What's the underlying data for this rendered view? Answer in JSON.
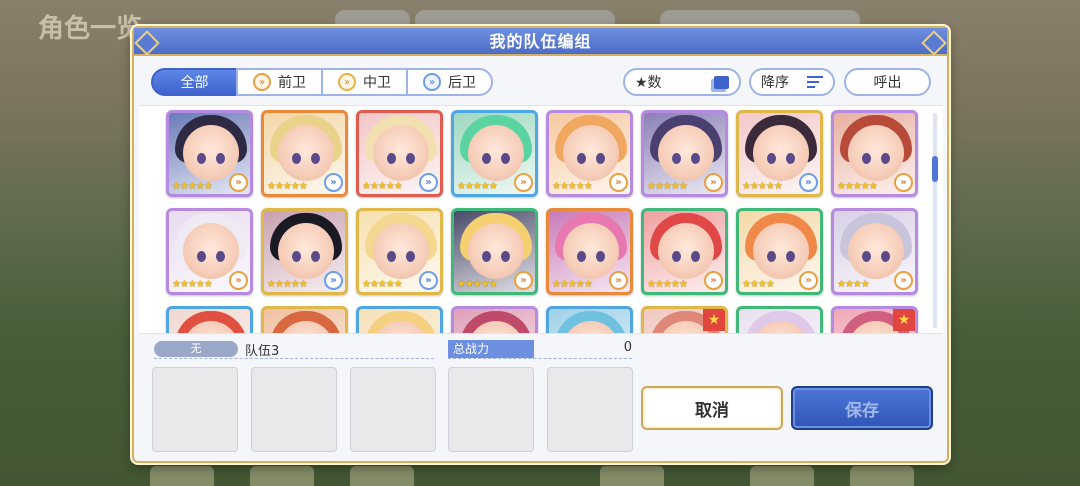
{
  "background": {
    "title": "角色一览"
  },
  "dialog": {
    "title": "我的队伍编组"
  },
  "filters": {
    "tabs": [
      {
        "label": "全部",
        "active": true,
        "icon": ""
      },
      {
        "label": "前卫",
        "active": false,
        "icon": "front-position-icon"
      },
      {
        "label": "中卫",
        "active": false,
        "icon": "middle-position-icon"
      },
      {
        "label": "后卫",
        "active": false,
        "icon": "back-position-icon"
      }
    ],
    "sort_label": "★数",
    "order_label": "降序",
    "call_label": "呼出"
  },
  "roster": {
    "rows": [
      [
        {
          "frame": "#b68ae0",
          "bg": "#6a7bb8",
          "hair": "#2e2a44",
          "stars": 5,
          "pos": "front"
        },
        {
          "frame": "#e98a3a",
          "bg": "#f3d7a8",
          "hair": "#e9d28a",
          "stars": 5,
          "pos": "back"
        },
        {
          "frame": "#e05c4e",
          "bg": "#f3c6c6",
          "hair": "#f2e0b0",
          "stars": 5,
          "pos": "back"
        },
        {
          "frame": "#4fa6e0",
          "bg": "#9fd8c0",
          "hair": "#5ad4a0",
          "stars": 5,
          "pos": "front"
        },
        {
          "frame": "#b68ae0",
          "bg": "#f6c9a0",
          "hair": "#f0a860",
          "stars": 5,
          "pos": "front"
        },
        {
          "frame": "#b68ae0",
          "bg": "#8a7fb8",
          "hair": "#4a4070",
          "stars": 5,
          "pos": "front"
        },
        {
          "frame": "#e0b84a",
          "bg": "#f3c8c8",
          "hair": "#3a2a3a",
          "stars": 5,
          "pos": "back"
        },
        {
          "frame": "#b68ae0",
          "bg": "#e8b0a0",
          "hair": "#b84a3a",
          "stars": 5,
          "pos": "front"
        }
      ],
      [
        {
          "frame": "#b68ae0",
          "bg": "#e8dcf0",
          "hair": "#f0eaf4",
          "stars": 5,
          "pos": "front"
        },
        {
          "frame": "#e0b84a",
          "bg": "#c8a0b0",
          "hair": "#1a1a24",
          "stars": 5,
          "pos": "back"
        },
        {
          "frame": "#e0b84a",
          "bg": "#f6e0b0",
          "hair": "#f4d890",
          "stars": 5,
          "pos": "back"
        },
        {
          "frame": "#3fb87a",
          "bg": "#4a4a6a",
          "hair": "#f4d070",
          "stars": 5,
          "pos": "front"
        },
        {
          "frame": "#e98a3a",
          "bg": "#c87ab8",
          "hair": "#e878b0",
          "stars": 5,
          "pos": "front"
        },
        {
          "frame": "#3fb87a",
          "bg": "#f0a0a0",
          "hair": "#e04848",
          "stars": 5,
          "pos": "front"
        },
        {
          "frame": "#3fb87a",
          "bg": "#f4d8a8",
          "hair": "#f08848",
          "stars": 4,
          "pos": "front"
        },
        {
          "frame": "#b68ae0",
          "bg": "#d8d0e8",
          "hair": "#c8c4dc",
          "stars": 4,
          "pos": "front"
        }
      ],
      [
        {
          "frame": "#4fa6e0",
          "bg": "#f0d8d0",
          "hair": "#e05040",
          "stars": 0,
          "pos": "",
          "badge": false
        },
        {
          "frame": "#e0b84a",
          "bg": "#f0c0a0",
          "hair": "#d86840",
          "stars": 0,
          "pos": "",
          "badge": false
        },
        {
          "frame": "#4fa6e0",
          "bg": "#f6e0b8",
          "hair": "#f4d080",
          "stars": 0,
          "pos": "",
          "badge": false
        },
        {
          "frame": "#b68ae0",
          "bg": "#e0a0b8",
          "hair": "#c04a6a",
          "stars": 0,
          "pos": "",
          "badge": false
        },
        {
          "frame": "#4fa6e0",
          "bg": "#a0d0e8",
          "hair": "#70c0e0",
          "stars": 0,
          "pos": "",
          "badge": false
        },
        {
          "frame": "#e0b84a",
          "bg": "#f0c8c0",
          "hair": "#e08878",
          "stars": 0,
          "pos": "",
          "badge": true
        },
        {
          "frame": "#3fb87a",
          "bg": "#e8e0f0",
          "hair": "#e0c8e8",
          "stars": 0,
          "pos": "",
          "badge": false
        },
        {
          "frame": "#b68ae0",
          "bg": "#f0a8b8",
          "hair": "#d06080",
          "stars": 0,
          "pos": "",
          "badge": true
        }
      ]
    ]
  },
  "team": {
    "tag": "无",
    "name": "队伍3",
    "power_label": "总战力",
    "power_value": "0",
    "slots": 5
  },
  "buttons": {
    "cancel": "取消",
    "save": "保存"
  },
  "glyphs": {
    "star": "★",
    "badge": "★",
    "pos_arrow": "»"
  }
}
